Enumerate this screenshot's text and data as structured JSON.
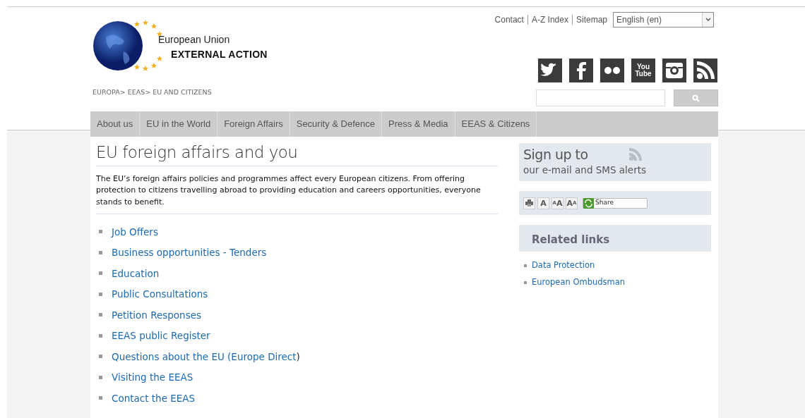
{
  "top_links": [
    "Contact",
    "A-Z Index",
    "Sitemap"
  ],
  "language": {
    "value": "English (en)"
  },
  "logo": {
    "line1": "European Union",
    "line2": "EXTERNAL ACTION"
  },
  "breadcrumb": "EUROPA> EEAS> EU AND CITIZENS",
  "social": [
    {
      "kind": "twitter"
    },
    {
      "kind": "facebook"
    },
    {
      "kind": "flickr"
    },
    {
      "kind": "youtube",
      "label": "You Tube"
    },
    {
      "kind": "instagram"
    },
    {
      "kind": "rss"
    }
  ],
  "nav": [
    {
      "label": "About us",
      "selected": false
    },
    {
      "label": "EU in the World",
      "selected": false
    },
    {
      "label": "Foreign Affairs",
      "selected": false
    },
    {
      "label": "Security & Defence",
      "selected": false
    },
    {
      "label": "Press & Media",
      "selected": false
    },
    {
      "label": "EEAS & Citizens",
      "selected": false
    }
  ],
  "main": {
    "title": "EU foreign affairs and you",
    "intro": "The EU’s foreign affairs policies and programmes affect every European citizens. From offering protection to citizens travelling abroad to providing education and careers opportunities, everyone stands to benefit.",
    "links": [
      {
        "label": "Job Offers"
      },
      {
        "label": "Business opportunities - Tenders"
      },
      {
        "label": "Education"
      },
      {
        "label": "Public Consultations"
      },
      {
        "label": "Petition Responses"
      },
      {
        "label": "EEAS public Register"
      },
      {
        "label": "Questions about the EU (Europe Direct",
        "suffix": ")"
      },
      {
        "label": "Visiting the EEAS"
      },
      {
        "label": "Contact the EEAS"
      }
    ]
  },
  "signup": {
    "title": "Sign up to",
    "subtitle": "our e-mail and SMS alerts"
  },
  "tools": {
    "font_buttons": [
      {
        "kind": "normal",
        "label": "A"
      },
      {
        "kind": "larger",
        "label": "AA"
      },
      {
        "kind": "smaller",
        "label": "AA"
      }
    ],
    "share": "Share"
  },
  "related": {
    "title": "Related links",
    "links": [
      "Data Protection",
      "European Ombudsman"
    ]
  }
}
